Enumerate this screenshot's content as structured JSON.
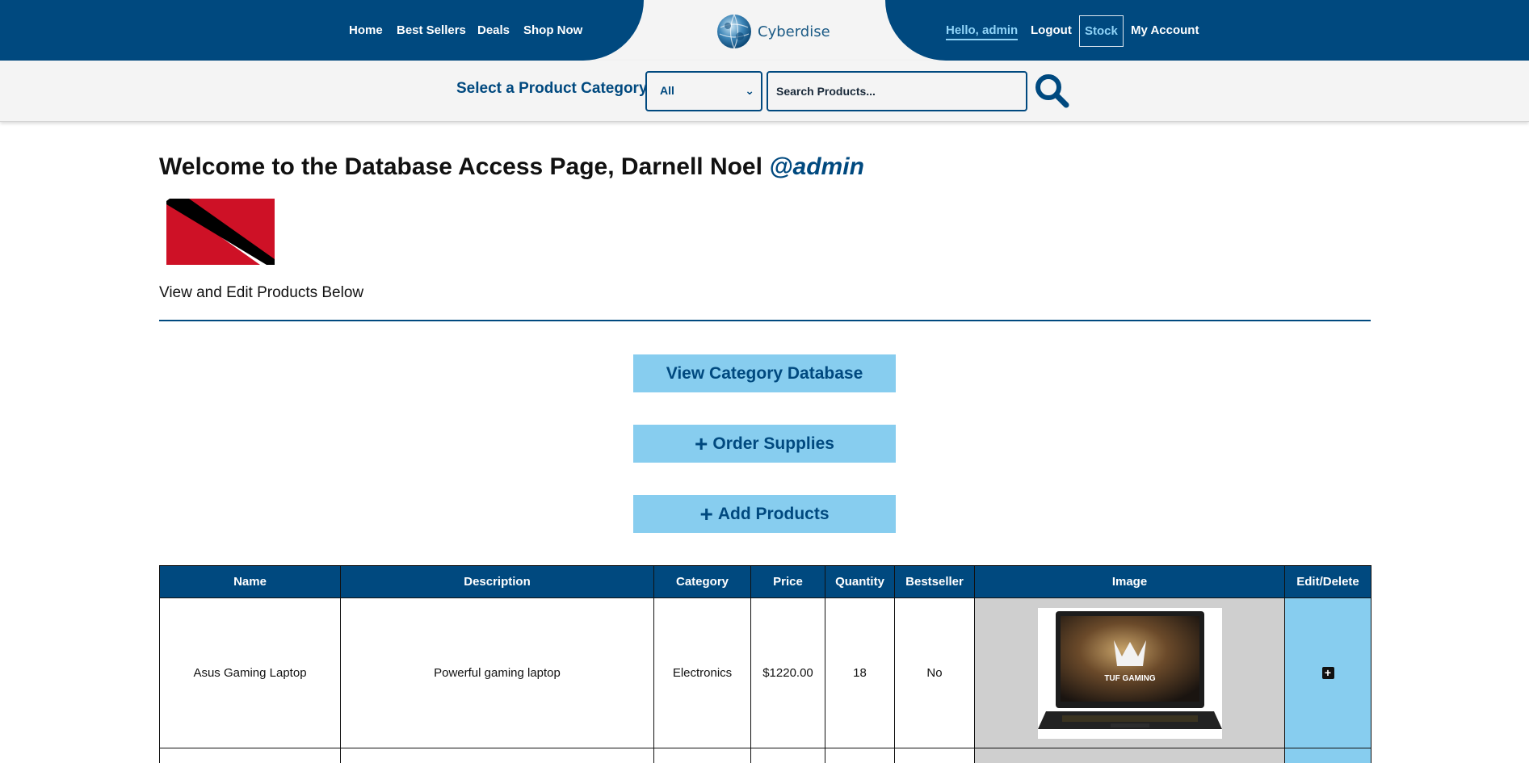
{
  "nav": {
    "left": [
      "Home",
      "Best Sellers",
      "Deals",
      "Shop Now"
    ],
    "brand": "Cyberdise",
    "hello": "Hello, admin",
    "logout": "Logout",
    "stock": "Stock",
    "account": "My Account"
  },
  "search": {
    "category_label": "Select a Product Category",
    "category_selected": "All",
    "placeholder": "Search Products..."
  },
  "page": {
    "welcome_prefix": "Welcome to the Database Access Page, Darnell Noel",
    "handle": "@admin",
    "subtitle": "View and Edit Products Below"
  },
  "actions": {
    "view_category": "View Category Database",
    "order_supplies": "Order Supplies",
    "add_products": "Add Products"
  },
  "table": {
    "headers": [
      "Name",
      "Description",
      "Category",
      "Price",
      "Quantity",
      "Bestseller",
      "Image",
      "Edit/Delete"
    ],
    "rows": [
      {
        "name": "Asus Gaming Laptop",
        "description": "Powerful gaming laptop",
        "category": "Electronics",
        "price": "$1220.00",
        "quantity": "18",
        "bestseller": "No",
        "image_text": "TUF GAMING"
      }
    ]
  },
  "colors": {
    "navy": "#00497f",
    "light_blue": "#87cdef",
    "hello_link": "#8fd3f7",
    "image_cell_bg": "#cfcfcf",
    "flag_red": "#ce1126"
  },
  "icons": [
    "globe-logo-icon",
    "search-icon",
    "plus-icon",
    "chevron-down-icon",
    "edit-plus-icon"
  ]
}
